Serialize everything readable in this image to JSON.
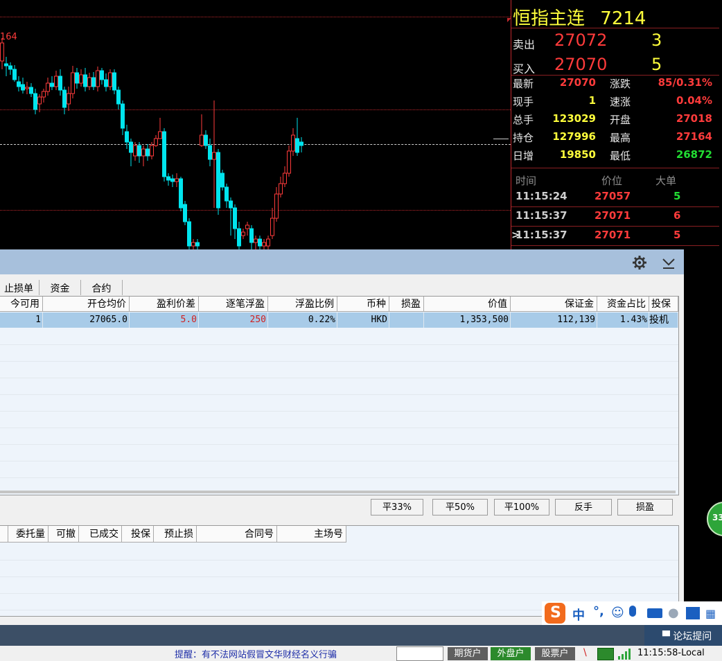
{
  "chart": {
    "price_tag": "164",
    "candles": [
      [
        3,
        88,
        62,
        100,
        55
      ],
      [
        9,
        92,
        95,
        110,
        82
      ],
      [
        15,
        95,
        100,
        108,
        90
      ],
      [
        21,
        100,
        115,
        118,
        94
      ],
      [
        27,
        118,
        125,
        132,
        110
      ],
      [
        33,
        122,
        130,
        135,
        112
      ],
      [
        39,
        128,
        126,
        136,
        118
      ],
      [
        45,
        126,
        135,
        140,
        120
      ],
      [
        51,
        135,
        158,
        165,
        128
      ],
      [
        57,
        150,
        140,
        162,
        136
      ],
      [
        63,
        140,
        132,
        148,
        128
      ],
      [
        69,
        132,
        120,
        138,
        112
      ],
      [
        75,
        120,
        125,
        130,
        110
      ],
      [
        81,
        125,
        110,
        130,
        102
      ],
      [
        87,
        110,
        130,
        138,
        100
      ],
      [
        93,
        130,
        155,
        165,
        125
      ],
      [
        99,
        150,
        135,
        160,
        125
      ],
      [
        105,
        135,
        105,
        142,
        95
      ],
      [
        111,
        105,
        120,
        128,
        98
      ],
      [
        117,
        120,
        108,
        125,
        100
      ],
      [
        123,
        108,
        125,
        132,
        98
      ],
      [
        129,
        125,
        112,
        130,
        105
      ],
      [
        135,
        112,
        125,
        130,
        104
      ],
      [
        141,
        125,
        102,
        132,
        96
      ],
      [
        147,
        102,
        115,
        122,
        98
      ],
      [
        153,
        115,
        125,
        132,
        106
      ],
      [
        159,
        125,
        105,
        130,
        100
      ],
      [
        165,
        105,
        130,
        136,
        100
      ],
      [
        171,
        130,
        150,
        158,
        125
      ],
      [
        177,
        150,
        185,
        195,
        145
      ],
      [
        183,
        190,
        205,
        215,
        180
      ],
      [
        189,
        205,
        220,
        240,
        200
      ],
      [
        195,
        225,
        210,
        232,
        205
      ],
      [
        201,
        210,
        225,
        235,
        205
      ],
      [
        207,
        225,
        215,
        240,
        210
      ],
      [
        213,
        215,
        225,
        232,
        208
      ],
      [
        219,
        225,
        210,
        230,
        205
      ],
      [
        225,
        210,
        200,
        212,
        195
      ],
      [
        231,
        200,
        190,
        200,
        170
      ],
      [
        237,
        190,
        255,
        262,
        185
      ],
      [
        243,
        255,
        260,
        268,
        250
      ],
      [
        249,
        258,
        262,
        270,
        252
      ],
      [
        255,
        262,
        258,
        270,
        250
      ],
      [
        261,
        258,
        300,
        305,
        255
      ],
      [
        267,
        295,
        320,
        325,
        290
      ],
      [
        273,
        320,
        355,
        360,
        315
      ],
      [
        279,
        355,
        350,
        360,
        345
      ],
      [
        285,
        350,
        355,
        360,
        345
      ],
      [
        291,
        210,
        195,
        212,
        165
      ],
      [
        297,
        195,
        210,
        215,
        188
      ],
      [
        303,
        210,
        230,
        240,
        200
      ],
      [
        309,
        230,
        220,
        300,
        145
      ],
      [
        315,
        220,
        300,
        310,
        215
      ],
      [
        321,
        250,
        270,
        275,
        245
      ],
      [
        327,
        270,
        290,
        300,
        265
      ],
      [
        333,
        290,
        300,
        340,
        285
      ],
      [
        339,
        300,
        330,
        345,
        295
      ],
      [
        345,
        330,
        355,
        360,
        320
      ],
      [
        351,
        340,
        335,
        345,
        330
      ],
      [
        357,
        330,
        325,
        340,
        320
      ],
      [
        363,
        330,
        350,
        360,
        325
      ],
      [
        369,
        350,
        345,
        360,
        340
      ],
      [
        375,
        345,
        355,
        360,
        340
      ],
      [
        381,
        355,
        350,
        360,
        345
      ],
      [
        387,
        355,
        345,
        360,
        340
      ],
      [
        393,
        340,
        315,
        345,
        300
      ],
      [
        399,
        315,
        280,
        320,
        270
      ],
      [
        405,
        280,
        265,
        285,
        255
      ],
      [
        411,
        265,
        250,
        270,
        240
      ],
      [
        417,
        250,
        218,
        255,
        210
      ],
      [
        423,
        218,
        195,
        225,
        185
      ],
      [
        429,
        200,
        220,
        225,
        170
      ],
      [
        435,
        205,
        210,
        220,
        198
      ]
    ]
  },
  "quote": {
    "name": "恒指主连",
    "code": "7214",
    "ask_label": "卖出",
    "ask_price": "27072",
    "ask_vol": "3",
    "bid_label": "买入",
    "bid_price": "27070",
    "bid_vol": "5",
    "stats": [
      {
        "l1": "最新",
        "v1": "27070",
        "c1": "#ff3b3b",
        "l2": "涨跌",
        "v2": "85/0.31%",
        "c2": "#ff3b3b"
      },
      {
        "l1": "现手",
        "v1": "1",
        "c1": "#ffff3b",
        "l2": "速涨",
        "v2": "0.04%",
        "c2": "#ff3b3b"
      },
      {
        "l1": "总手",
        "v1": "123029",
        "c1": "#ffff3b",
        "l2": "开盘",
        "v2": "27018",
        "c2": "#ff3b3b"
      },
      {
        "l1": "持仓",
        "v1": "127996",
        "c1": "#ffff3b",
        "l2": "最高",
        "v2": "27164",
        "c2": "#ff3b3b"
      },
      {
        "l1": "日增",
        "v1": "19850",
        "c1": "#ffff3b",
        "l2": "最低",
        "v2": "26872",
        "c2": "#22dd33"
      }
    ],
    "tick_headers": [
      "时间",
      "价位",
      "大单"
    ],
    "ticks": [
      {
        "time": "11:15:24",
        "price": "27057",
        "vol": "5",
        "vc": "#22dd33",
        "mark": ""
      },
      {
        "time": "11:15:37",
        "price": "27071",
        "vol": "6",
        "vc": "#ff3b3b",
        "mark": ""
      },
      {
        "time": "11:15:37",
        "price": "27071",
        "vol": "5",
        "vc": "#ff3b3b",
        "mark": ">"
      }
    ]
  },
  "trade": {
    "tabs": [
      "止损单",
      "资金",
      "合约"
    ],
    "headers": [
      "今可用",
      "开仓均价",
      "盈利价差",
      "逐笔浮盈",
      "浮盈比例",
      "币种",
      "损盈",
      "价值",
      "保证金",
      "资金占比",
      "投保"
    ],
    "row": [
      "1",
      "27065.0",
      "5.0",
      "250",
      "0.22%",
      "HKD",
      "",
      "1,353,500",
      "112,139",
      "1.43%",
      "投机"
    ],
    "buttons": [
      "平33%",
      "平50%",
      "平100%",
      "反手",
      "损盈"
    ],
    "headers2": [
      "委托量",
      "可撤",
      "已成交",
      "投保",
      "预止损",
      "合同号",
      "主场号"
    ]
  },
  "side_badge": "33",
  "ime": {
    "lang": "中",
    "punct": "°,"
  },
  "forum_label": "论坛提问",
  "status": {
    "notice": "提醒：有不法网站假冒文华财经名义行骗",
    "b1": "期货户",
    "b2": "外盘户",
    "b3": "股票户",
    "time": "11:15:58-Local"
  },
  "colors": {
    "red": "#ff3b3b",
    "yellow": "#ffff3b",
    "cyan": "#00e5ee",
    "green": "#22dd33"
  }
}
